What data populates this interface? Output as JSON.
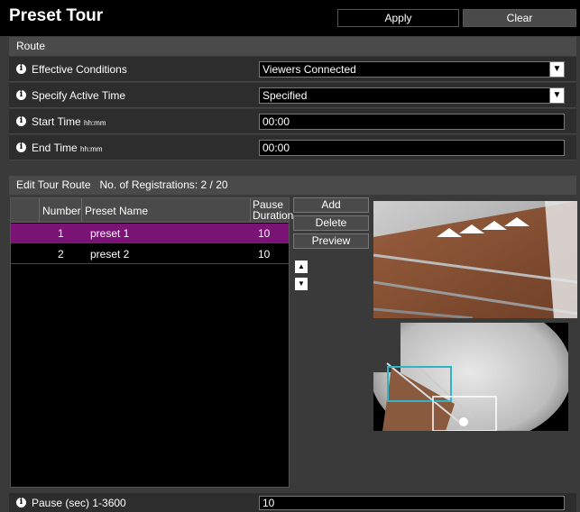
{
  "header": {
    "title": "Preset Tour",
    "apply_label": "Apply",
    "clear_label": "Clear"
  },
  "route": {
    "section_label": "Route",
    "effective_conditions": {
      "label": "Effective Conditions",
      "value": "Viewers Connected"
    },
    "active_time": {
      "label": "Specify Active Time",
      "value": "Specified"
    },
    "start_time": {
      "label": "Start Time",
      "hint": "hh:mm",
      "value": "00:00"
    },
    "end_time": {
      "label": "End Time",
      "hint": "hh:mm",
      "value": "00:00"
    }
  },
  "tour": {
    "section_label": "Edit Tour Route   No. of Registrations: 2 / 20",
    "columns": {
      "number": "Number",
      "name": "Preset Name",
      "pause_line1": "Pause",
      "pause_line2": "Duration"
    },
    "rows": [
      {
        "number": "1",
        "name": "preset 1",
        "pause": "10",
        "selected": true
      },
      {
        "number": "2",
        "name": "preset 2",
        "pause": "10",
        "selected": false
      }
    ],
    "add_label": "Add",
    "delete_label": "Delete",
    "preview_label": "Preview"
  },
  "pause": {
    "label": "Pause (sec) 1-3600",
    "value": "10"
  },
  "icons": {
    "info": "info-icon",
    "up": "arrow-up-icon",
    "down": "arrow-down-icon",
    "dropdown": "chevron-down-icon"
  },
  "colors": {
    "selected_row": "#7a1375",
    "panel": "#3a3a3a",
    "section_bar": "#4a4a4a"
  }
}
